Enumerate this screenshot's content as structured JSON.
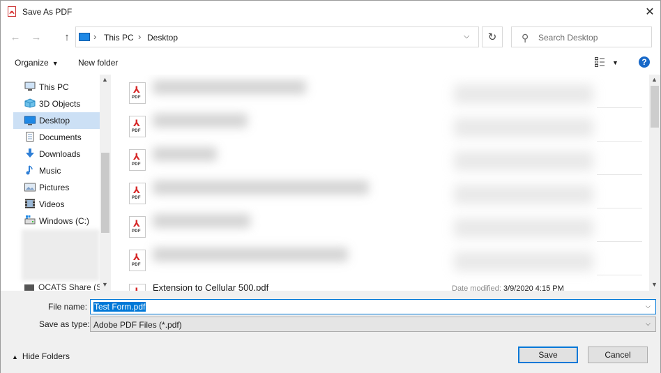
{
  "window": {
    "title": "Save As PDF",
    "close_glyph": "✕"
  },
  "nav": {
    "back_icon": "arrow-left-icon",
    "forward_icon": "arrow-right-icon",
    "up_icon": "arrow-up-icon",
    "breadcrumbs": [
      "This PC",
      "Desktop"
    ],
    "refresh_icon": "refresh-icon"
  },
  "search": {
    "placeholder": "Search Desktop"
  },
  "toolbar": {
    "organize_label": "Organize",
    "new_folder_label": "New folder",
    "help_label": "?"
  },
  "sidebar": {
    "items": [
      {
        "label": "This PC",
        "icon": "pc-icon"
      },
      {
        "label": "3D Objects",
        "icon": "cube-icon"
      },
      {
        "label": "Desktop",
        "icon": "desktop-icon",
        "selected": true
      },
      {
        "label": "Documents",
        "icon": "document-icon"
      },
      {
        "label": "Downloads",
        "icon": "download-icon"
      },
      {
        "label": "Music",
        "icon": "music-icon"
      },
      {
        "label": "Pictures",
        "icon": "picture-icon"
      },
      {
        "label": "Videos",
        "icon": "video-icon"
      },
      {
        "label": "Windows (C:)",
        "icon": "drive-icon"
      }
    ],
    "partial_item": "OCATS Share (S:"
  },
  "files": {
    "pdf_label": "PDF",
    "partial_row": {
      "name": "Extension to Cellular 500.pdf",
      "meta_label": "Date modified:",
      "meta_value": "3/9/2020 4:15 PM"
    }
  },
  "form": {
    "filename_label": "File name:",
    "filename_value": "Test Form.pdf",
    "savetype_label": "Save as type:",
    "savetype_value": "Adobe PDF Files (*.pdf)"
  },
  "footer": {
    "hide_folders_label": "Hide Folders",
    "save_label": "Save",
    "cancel_label": "Cancel"
  },
  "colors": {
    "accent": "#0078d7",
    "pdf_red": "#d62828",
    "selection": "#cce0f5"
  }
}
